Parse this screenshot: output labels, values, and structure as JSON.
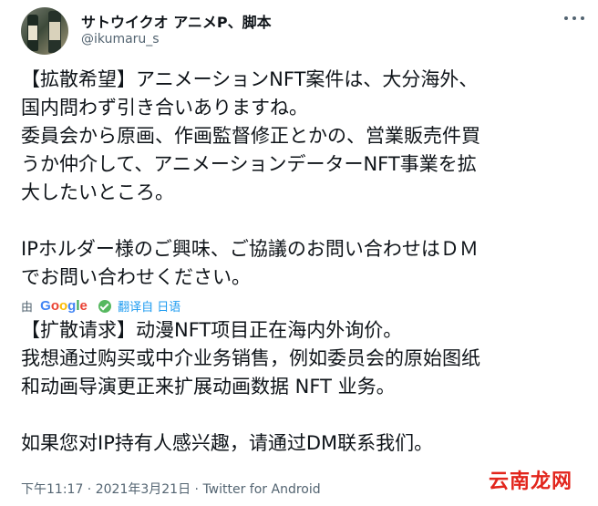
{
  "author": {
    "display_name": "サトウイクオ アニメP、脚本",
    "handle": "@ikumaru_s"
  },
  "tweet": {
    "text": "【拡散希望】アニメーションNFT案件は、大分海外、\n国内問わず引き合いありますね。\n委員会から原画、作画監督修正とかの、営業販売件買\nうか仲介して、アニメーションデーターNFT事業を拡\n大したいところ。\n\nIPホルダー様のご興味、ご協議のお問い合わせはＤＭ\nでお問い合わせください。"
  },
  "translation": {
    "by_label": "由",
    "provider_letters": [
      "G",
      "o",
      "o",
      "g",
      "l",
      "e"
    ],
    "provider_colors": [
      "#4285f4",
      "#ea4335",
      "#fbbc05",
      "#4285f4",
      "#34a853",
      "#ea4335"
    ],
    "link_label": "翻译自 日语",
    "text": "【扩散请求】动漫NFT项目正在海内外询价。\n我想通过购买或中介业务销售，例如委员会的原始图纸\n和动画导演更正来扩展动画数据 NFT 业务。\n\n如果您对IP持有人感兴趣，请通过DM联系我们。"
  },
  "meta": {
    "time": "下午11:17",
    "date": "2021年3月21日",
    "separator": " · ",
    "source": "Twitter for Android"
  },
  "watermark": "云南龙网"
}
